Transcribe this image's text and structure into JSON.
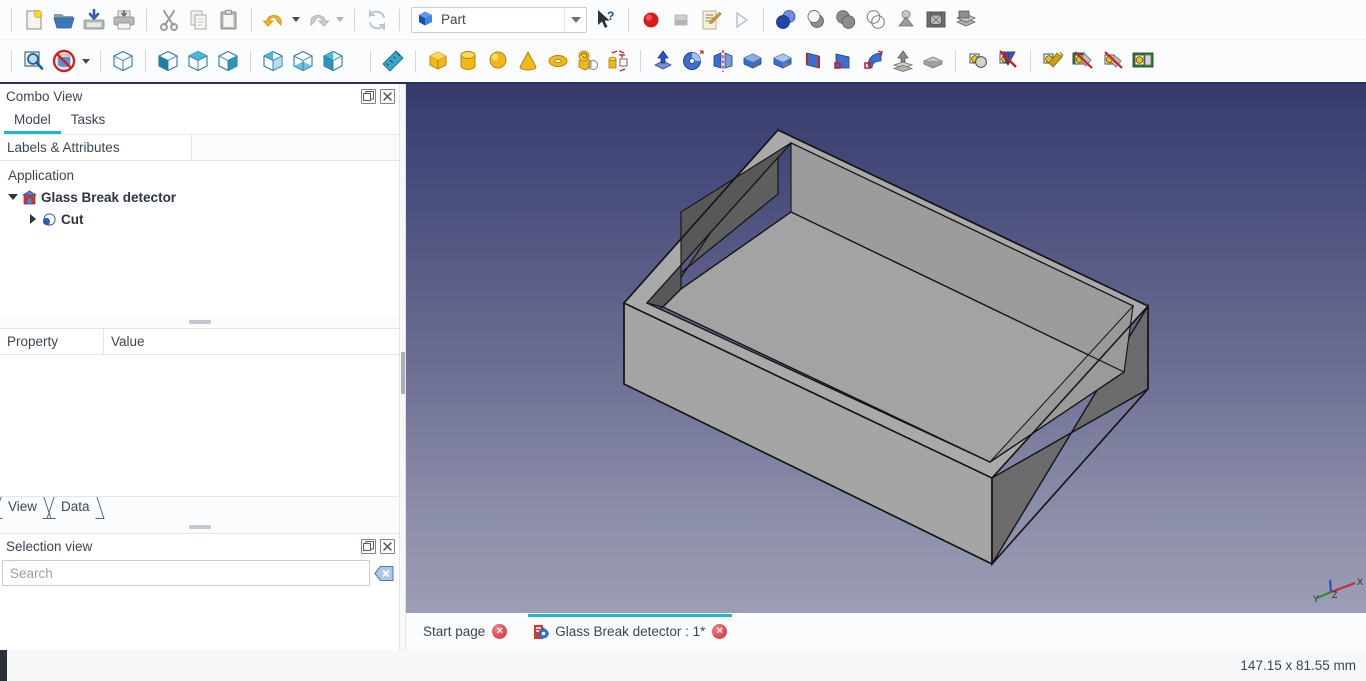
{
  "app": {
    "workbench": "Part",
    "workbench_icon": "part-box-icon"
  },
  "toolbar_file": {
    "items": [
      {
        "name": "new-document-button",
        "label": "New"
      },
      {
        "name": "open-document-button",
        "label": "Open"
      },
      {
        "name": "save-document-button",
        "label": "Save"
      },
      {
        "name": "print-document-button",
        "label": "Print"
      },
      {
        "name": "cut-button",
        "label": "Cut"
      },
      {
        "name": "copy-button",
        "label": "Copy"
      },
      {
        "name": "paste-button",
        "label": "Paste"
      },
      {
        "name": "undo-button",
        "label": "Undo"
      },
      {
        "name": "redo-button",
        "label": "Redo"
      },
      {
        "name": "refresh-button",
        "label": "Refresh"
      },
      {
        "name": "whats-this-button",
        "label": "What's This?"
      },
      {
        "name": "macro-record-button",
        "label": "Macro recording"
      },
      {
        "name": "macro-stop-button",
        "label": "Stop macro recording"
      },
      {
        "name": "macro-edit-button",
        "label": "Macros"
      },
      {
        "name": "macro-execute-button",
        "label": "Execute macro"
      }
    ]
  },
  "toolbar_boolean": {
    "items": [
      {
        "name": "boolean-button",
        "label": "Boolean"
      },
      {
        "name": "cut-boolean-button",
        "label": "Cut"
      },
      {
        "name": "union-button",
        "label": "Union"
      },
      {
        "name": "intersection-button",
        "label": "Intersection"
      },
      {
        "name": "check-geometry-button",
        "label": "Check geometry"
      },
      {
        "name": "section-button",
        "label": "Section"
      },
      {
        "name": "cross-sections-button",
        "label": "Cross-sections"
      }
    ]
  },
  "toolbar_view": {
    "items": [
      {
        "name": "fit-all-button",
        "label": "Fit all"
      },
      {
        "name": "draw-style-button",
        "label": "Draw style"
      },
      {
        "name": "axonometric-view-button",
        "label": "Isometric"
      },
      {
        "name": "front-view-button",
        "label": "Front"
      },
      {
        "name": "top-view-button",
        "label": "Top"
      },
      {
        "name": "right-view-button",
        "label": "Right"
      },
      {
        "name": "rear-view-button",
        "label": "Rear"
      },
      {
        "name": "bottom-view-button",
        "label": "Bottom"
      },
      {
        "name": "left-view-button",
        "label": "Left"
      }
    ]
  },
  "toolbar_part": {
    "items": [
      {
        "name": "measure-button",
        "label": "Measure"
      },
      {
        "name": "box-primitive-button",
        "label": "Cube"
      },
      {
        "name": "cylinder-primitive-button",
        "label": "Cylinder"
      },
      {
        "name": "sphere-primitive-button",
        "label": "Sphere"
      },
      {
        "name": "cone-primitive-button",
        "label": "Cone"
      },
      {
        "name": "torus-primitive-button",
        "label": "Torus"
      },
      {
        "name": "create-primitives-button",
        "label": "Create primitives"
      },
      {
        "name": "shape-builder-button",
        "label": "Shape builder"
      },
      {
        "name": "extrude-button",
        "label": "Extrude"
      },
      {
        "name": "revolve-button",
        "label": "Revolve"
      },
      {
        "name": "mirror-button",
        "label": "Mirror"
      },
      {
        "name": "fillet-button",
        "label": "Fillet"
      },
      {
        "name": "chamfer-button",
        "label": "Chamfer"
      },
      {
        "name": "ruled-surface-button",
        "label": "Ruled surface"
      },
      {
        "name": "loft-button",
        "label": "Loft"
      },
      {
        "name": "sweep-button",
        "label": "Sweep"
      },
      {
        "name": "offset-button",
        "label": "3D offset"
      },
      {
        "name": "thickness-button",
        "label": "Thickness"
      },
      {
        "name": "boolean-op-button",
        "label": "Boolean"
      },
      {
        "name": "cut-op-button",
        "label": "Cut"
      },
      {
        "name": "union-op-button",
        "label": "Union"
      },
      {
        "name": "intersect-op-button",
        "label": "Intersection"
      },
      {
        "name": "join-connect-button",
        "label": "Connect objects"
      },
      {
        "name": "split-apart-button",
        "label": "Split apart"
      }
    ]
  },
  "combo_view": {
    "title": "Combo View",
    "float_button": "float-panel-button",
    "close_button": "close-panel-button",
    "tabs": [
      {
        "label": "Model",
        "active": true
      },
      {
        "label": "Tasks",
        "active": false
      }
    ],
    "tree": {
      "columns": [
        "Labels & Attributes",
        ""
      ],
      "root_label": "Application",
      "nodes": [
        {
          "label": "Glass Break detector",
          "icon": "document-icon",
          "expanded": true,
          "level": 1
        },
        {
          "label": "Cut",
          "icon": "cut-feature-icon",
          "expanded": false,
          "level": 2
        }
      ]
    },
    "property_table": {
      "columns": [
        "Property",
        "Value"
      ],
      "rows": []
    },
    "property_tabs": [
      {
        "label": "View",
        "active": false
      },
      {
        "label": "Data",
        "active": true
      }
    ]
  },
  "selection_view": {
    "title": "Selection view",
    "float_button": "float-panel-button",
    "close_button": "close-panel-button",
    "search_placeholder": "Search",
    "search_value": "",
    "clear_button": "clear-search-icon",
    "items": []
  },
  "view3d": {
    "axis_labels": [
      "X",
      "Y",
      "Z"
    ],
    "axis_colors": {
      "x": "#c03030",
      "y": "#2f8f30",
      "z": "#3050c0"
    },
    "background_top": "#353a6d",
    "background_bottom": "#9b9eb5",
    "model_name": "Cut",
    "face_light": "#a8a8a8",
    "face_mid": "#9a9a9a",
    "face_dark": "#5f5f5f",
    "edge_color": "#1a1a1a"
  },
  "document_tabs": [
    {
      "label": "Start page",
      "icon": null,
      "active": false,
      "closable": true
    },
    {
      "label": "Glass Break detector : 1*",
      "icon": "freecad-document-icon",
      "active": true,
      "closable": true
    }
  ],
  "status_bar": {
    "dimensions": "147.15 x 81.55 mm"
  }
}
